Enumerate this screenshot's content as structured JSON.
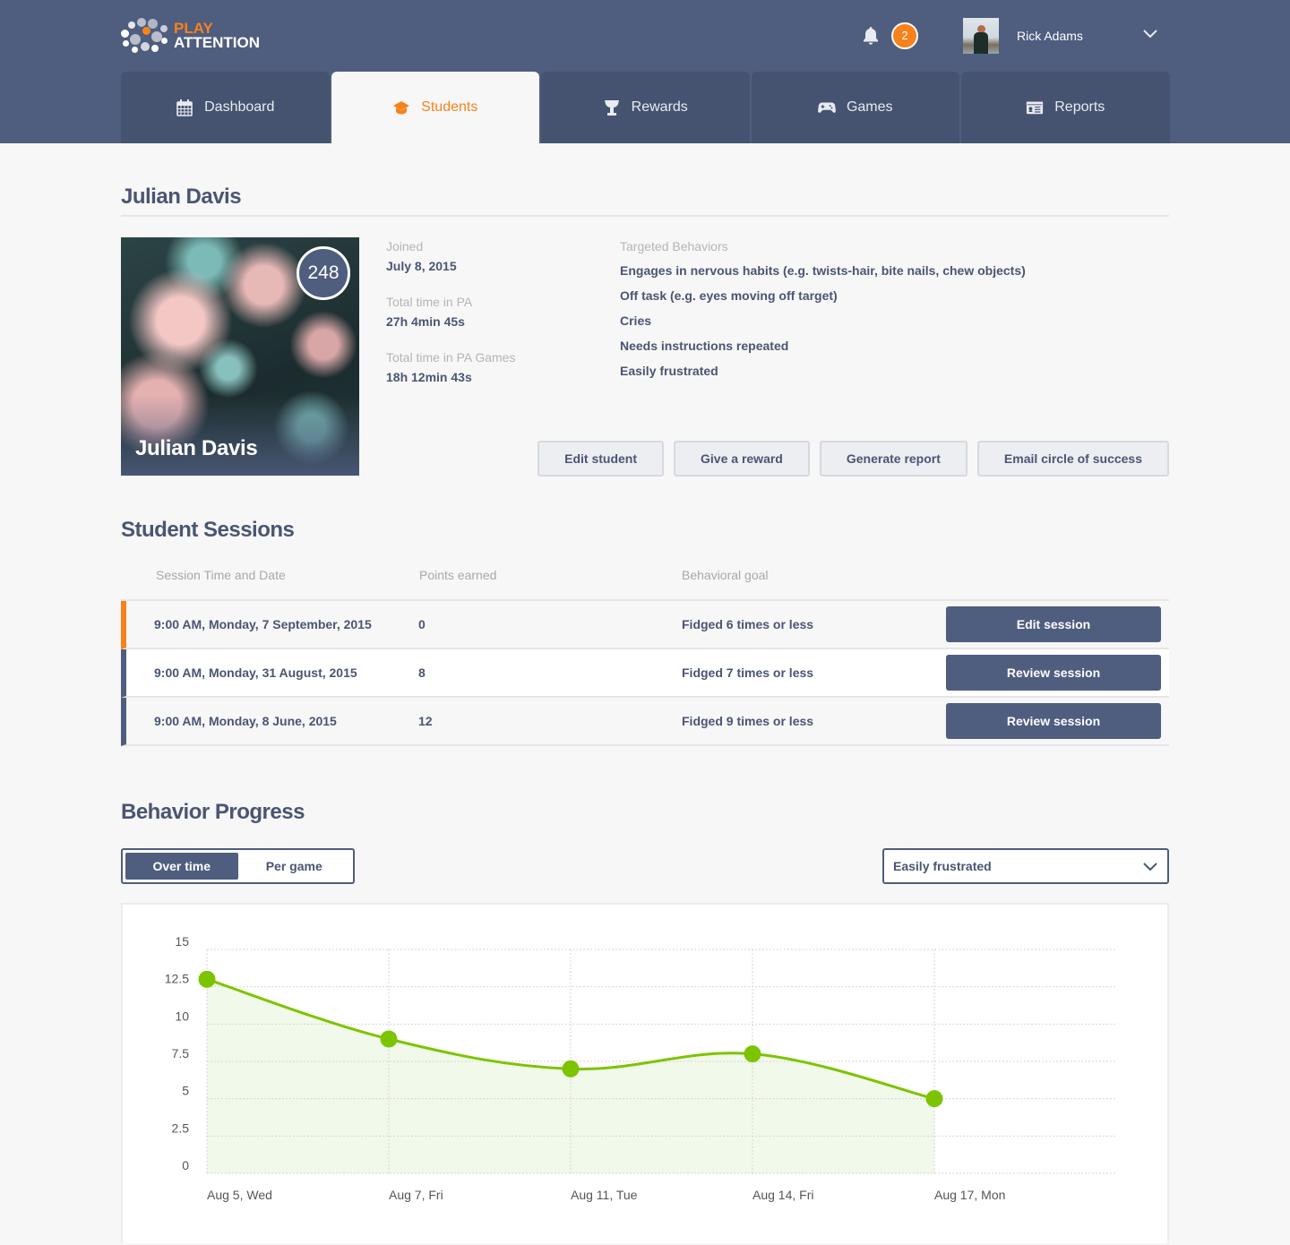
{
  "app": {
    "logo_line1": "PLAY",
    "logo_line2": "ATTENTION",
    "notifications_count": "2",
    "user_name": "Rick Adams",
    "icons": {
      "notifications": "bell-icon",
      "user_menu": "chevron-down-icon"
    }
  },
  "nav": {
    "tabs": [
      {
        "label": "Dashboard",
        "icon": "calendar-icon",
        "active": false
      },
      {
        "label": "Students",
        "icon": "graduation-cap-icon",
        "active": true
      },
      {
        "label": "Rewards",
        "icon": "trophy-icon",
        "active": false
      },
      {
        "label": "Games",
        "icon": "gamepad-icon",
        "active": false
      },
      {
        "label": "Reports",
        "icon": "report-card-icon",
        "active": false
      }
    ]
  },
  "student": {
    "name": "Julian Davis",
    "points": "248",
    "joined_label": "Joined",
    "joined_value": "July 8, 2015",
    "time_pa_label": "Total time in PA",
    "time_pa_value": "27h 4min 45s",
    "time_games_label": "Total time in PA Games",
    "time_games_value": "18h 12min 43s",
    "behaviors_label": "Targeted Behaviors",
    "behaviors": [
      "Engages in nervous habits (e.g. twists-hair, bite nails, chew objects)",
      "Off task (e.g. eyes moving off target)",
      "Cries",
      "Needs instructions repeated",
      "Easily frustrated"
    ],
    "actions": [
      "Edit student",
      "Give a reward",
      "Generate report",
      "Email circle of success"
    ]
  },
  "sessions": {
    "title": "Student Sessions",
    "columns": [
      "Session Time and Date",
      "Points earned",
      "Behavioral goal"
    ],
    "rows": [
      {
        "datetime": "9:00 AM, Monday, 7 September, 2015",
        "points": "0",
        "goal": "Fidged 6 times or less",
        "action": "Edit session",
        "current": true
      },
      {
        "datetime": "9:00 AM, Monday, 31 August, 2015",
        "points": "8",
        "goal": "Fidged 7 times or less",
        "action": "Review session",
        "current": false
      },
      {
        "datetime": "9:00 AM, Monday, 8 June, 2015",
        "points": "12",
        "goal": "Fidged 9 times or less",
        "action": "Review session",
        "current": false
      }
    ]
  },
  "progress": {
    "title": "Behavior Progress",
    "toggle": [
      "Over time",
      "Per game"
    ],
    "toggle_selected": "Over time",
    "behavior_select": "Easily frustrated"
  },
  "colors": {
    "brand_navy": "#4f5d7e",
    "accent_orange": "#f7821b",
    "chart_green": "#7dc400",
    "chart_fill": "#f0f8e8"
  },
  "chart_data": {
    "type": "area",
    "title": "",
    "xlabel": "",
    "ylabel": "",
    "categories": [
      "Aug 5, Wed",
      "Aug 7, Fri",
      "Aug 11, Tue",
      "Aug 14, Fri",
      "Aug 17, Mon"
    ],
    "series": [
      {
        "name": "Easily frustrated",
        "values": [
          13,
          9,
          7,
          8,
          5
        ]
      }
    ],
    "y_ticks": [
      "0",
      "2.5",
      "5",
      "7.5",
      "10",
      "12.5",
      "15"
    ],
    "ylim": [
      0,
      15
    ],
    "grid": true,
    "legend": "none",
    "smooth": true
  }
}
